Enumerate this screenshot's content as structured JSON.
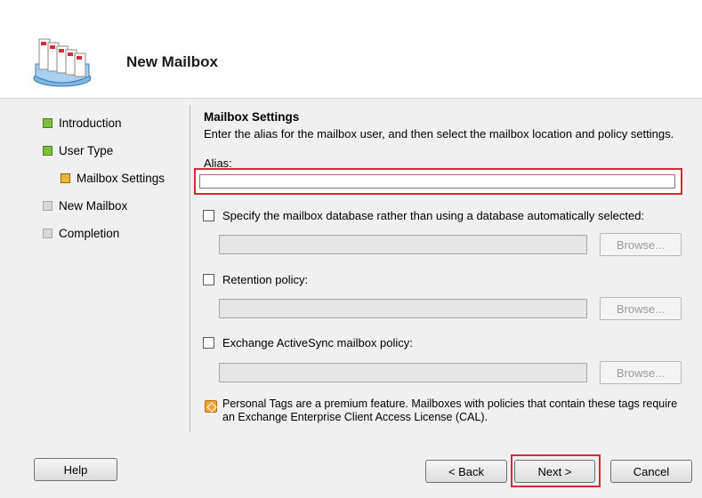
{
  "header": {
    "title": "New Mailbox",
    "icon": "mailbox-stack-icon"
  },
  "nav": {
    "items": [
      {
        "label": "Introduction",
        "state": "done"
      },
      {
        "label": "User Type",
        "state": "done"
      },
      {
        "label": "Mailbox Settings",
        "state": "current"
      },
      {
        "label": "New Mailbox",
        "state": "pending"
      },
      {
        "label": "Completion",
        "state": "pending"
      }
    ]
  },
  "content": {
    "section_title": "Mailbox Settings",
    "description": "Enter the alias for the mailbox user, and then select the mailbox location and policy settings.",
    "alias_label": "Alias:",
    "alias_value": "",
    "options": [
      {
        "label": "Specify the mailbox database rather than using a database automatically selected:",
        "checked": false,
        "browse_label": "Browse..."
      },
      {
        "label": "Retention policy:",
        "checked": false,
        "browse_label": "Browse..."
      },
      {
        "label": "Exchange ActiveSync mailbox policy:",
        "checked": false,
        "browse_label": "Browse..."
      }
    ],
    "note": "Personal Tags are a premium feature. Mailboxes with policies that contain these tags require an Exchange Enterprise Client Access License (CAL)."
  },
  "footer": {
    "help_label": "Help",
    "back_label": "< Back",
    "next_label": "Next >",
    "cancel_label": "Cancel"
  },
  "colors": {
    "highlight": "#d62b33",
    "done": "#7cbf3c",
    "current": "#f0b82a",
    "pending": "#d8d8d8"
  }
}
